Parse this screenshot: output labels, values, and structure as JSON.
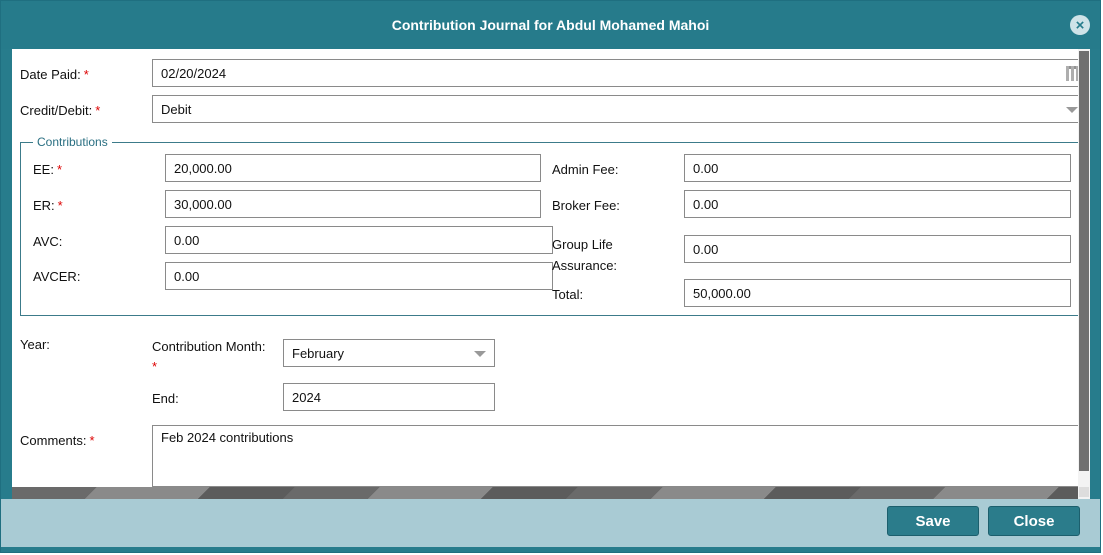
{
  "dialog": {
    "title": "Contribution Journal for Abdul Mohamed Mahoi",
    "close_icon": "close-circle-icon"
  },
  "form": {
    "date_paid": {
      "label": "Date Paid:",
      "value": "02/20/2024",
      "required": "*"
    },
    "credit_debit": {
      "label": "Credit/Debit:",
      "value": "Debit",
      "required": "*"
    },
    "contributions_legend": "Contributions",
    "ee": {
      "label": "EE:",
      "value": "20,000.00",
      "required": "*"
    },
    "er": {
      "label": "ER:",
      "value": "30,000.00",
      "required": "*"
    },
    "avc": {
      "label": "AVC:",
      "value": "0.00"
    },
    "avcer": {
      "label": "AVCER:",
      "value": "0.00"
    },
    "admin_fee": {
      "label": "Admin Fee:",
      "value": "0.00"
    },
    "broker_fee": {
      "label": "Broker Fee:",
      "value": "0.00"
    },
    "group_life": {
      "label_line1": "Group Life",
      "label_line2": "Assurance:",
      "value": "0.00"
    },
    "total": {
      "label": "Total:",
      "value": "50,000.00"
    },
    "year_label": "Year:",
    "contribution_month": {
      "label": "Contribution Month:",
      "value": "February",
      "required": "*"
    },
    "end": {
      "label": "End:",
      "value": "2024"
    },
    "comments": {
      "label": "Comments:",
      "value": "Feb 2024 contributions",
      "required": "*"
    }
  },
  "footer": {
    "save_label": "Save",
    "close_label": "Close"
  },
  "colors": {
    "accent": "#277c8c",
    "footer_bg": "#a9cbd4",
    "required": "#d00000"
  }
}
